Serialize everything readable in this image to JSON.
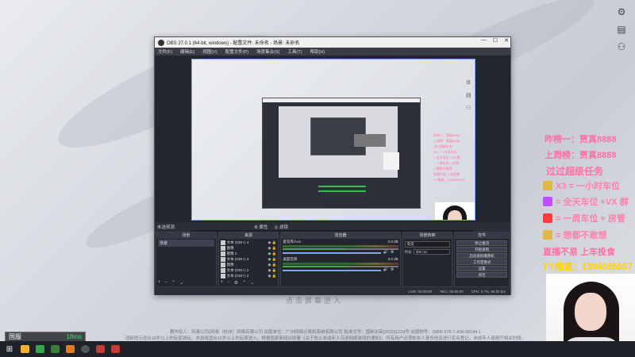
{
  "obs": {
    "title": "OBS 27.0.1 (64-bit, windows) - 配置文件: 未命名 - 场景: 未命名",
    "menu": [
      "文件(F)",
      "编辑(E)",
      "视图(V)",
      "配置文件(P)",
      "场景集合(S)",
      "工具(T)",
      "帮助(H)"
    ],
    "docks": {
      "scenes": "场景",
      "sources": "来源",
      "mixer": "混音器",
      "transitions": "场景转换",
      "controls": "控件"
    },
    "no_source": "未选择源",
    "properties_label": "属性",
    "filters_label": "滤镜",
    "scene_list": [
      "场景"
    ],
    "sources": [
      {
        "name": "文本 (GDI+) 4"
      },
      {
        "name": "图像"
      },
      {
        "name": "图像 2"
      },
      {
        "name": "文本 (GDI+) 3"
      },
      {
        "name": "图像"
      },
      {
        "name": "文本 (GDI+) 2"
      },
      {
        "name": "文本 (GDI+) 2"
      }
    ],
    "mixer": [
      {
        "name": "麦克风/Aux",
        "db": "0.0 dB"
      },
      {
        "name": "桌面音频",
        "db": "0.0 dB"
      }
    ],
    "transition": {
      "type": "渐变",
      "duration_label": "时长",
      "duration": "300 ms"
    },
    "controls": [
      "停止推流",
      "开始录制",
      "启动虚拟摄像机",
      "工作室模式",
      "设置",
      "退出"
    ],
    "status": {
      "live": "LIVE: 00:00:00",
      "rec": "REC: 00:00:00",
      "cpu": "CPU: 0.7%, 60.00 fps"
    }
  },
  "overlay": {
    "top1": "昨榜一：贾真8888",
    "top2": "上周榜：贾真8888",
    "task": "过过超级任务",
    "rows": [
      {
        "text": "X3 = 一小时车位",
        "color": "#e0b84a"
      },
      {
        "text": "= 全天车位 +VX 群",
        "color": "#c050ff"
      },
      {
        "text": "= 一周车位 + 房管",
        "color": "#ff3b3b"
      },
      {
        "text": "= 想都不敢想",
        "color": "#e0b84a"
      }
    ],
    "slogan": "直播不易 上车投食",
    "yy": "YY频道：1394085057"
  },
  "desktop": {
    "ghost_text": "点击屏幕进入",
    "legal1": "著作权人：网易公司(网易（杭州）网络有限公司 出版单位：广州网络计算机系统有限公司 批准文号：国新出审[2020]1229号 出版物号：ISBN 978-7-498-08184-1",
    "legal2": "适龄提示适合16岁以上的玩家游玩。本游戏适合16岁以上的玩家进入。根据国家新闻出版署《关于防止未成年人沉迷网络游戏的通知》，所有用户必须依本人身份信息进行实名登记，未成年人请避开相关时段。"
  },
  "widget": {
    "label": "国服",
    "ping": "18ms"
  },
  "colors": {
    "accent": "#7aa6ff",
    "pink": "#ff6fa6",
    "yellow": "#ffd200"
  }
}
